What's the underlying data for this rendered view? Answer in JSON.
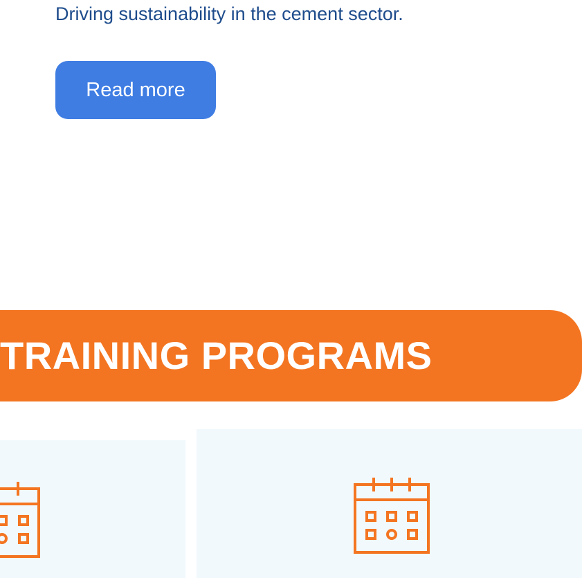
{
  "hero": {
    "tagline": "Driving sustainability in the cement sector.",
    "read_more_label": "Read more"
  },
  "training": {
    "section_title": "TRAINING PROGRAMS",
    "cards": [
      {
        "icon": "calendar-icon"
      },
      {
        "icon": "calendar-icon"
      }
    ]
  },
  "colors": {
    "tagline": "#1e4c8c",
    "button": "#3f7de3",
    "accent_orange": "#f47521",
    "card_background": "#f2f9fc"
  }
}
